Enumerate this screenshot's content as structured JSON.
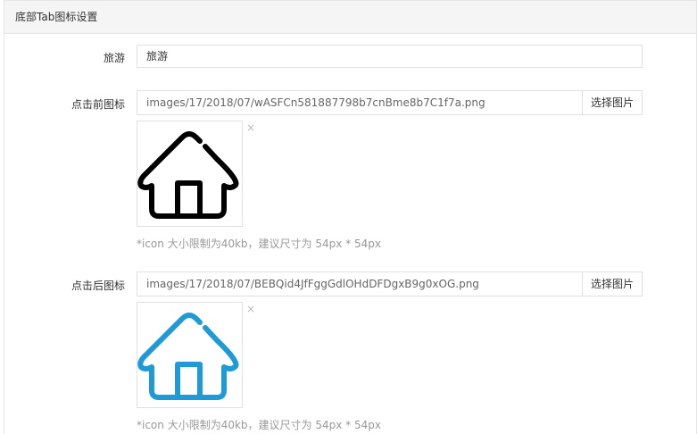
{
  "panel": {
    "title": "底部Tab图标设置"
  },
  "fields": {
    "name": {
      "label": "旅游",
      "value": "旅游"
    },
    "before": {
      "label": "点击前图标",
      "path": "images/17/2018/07/wASFCn581887798b7cnBme8b7C1f7a.png",
      "button": "选择图片",
      "remove": "×",
      "hint": "*icon 大小限制为40kb，建议尺寸为 54px * 54px",
      "icon": "house-icon",
      "icon_color": "#000000"
    },
    "after": {
      "label": "点击后图标",
      "path": "images/17/2018/07/BEBQid4JfFggGdlOHdDFDgxB9g0xOG.png",
      "button": "选择图片",
      "remove": "×",
      "hint": "*icon 大小限制为40kb，建议尺寸为 54px * 54px",
      "icon": "house-icon",
      "icon_color": "#1e9ad6"
    }
  }
}
